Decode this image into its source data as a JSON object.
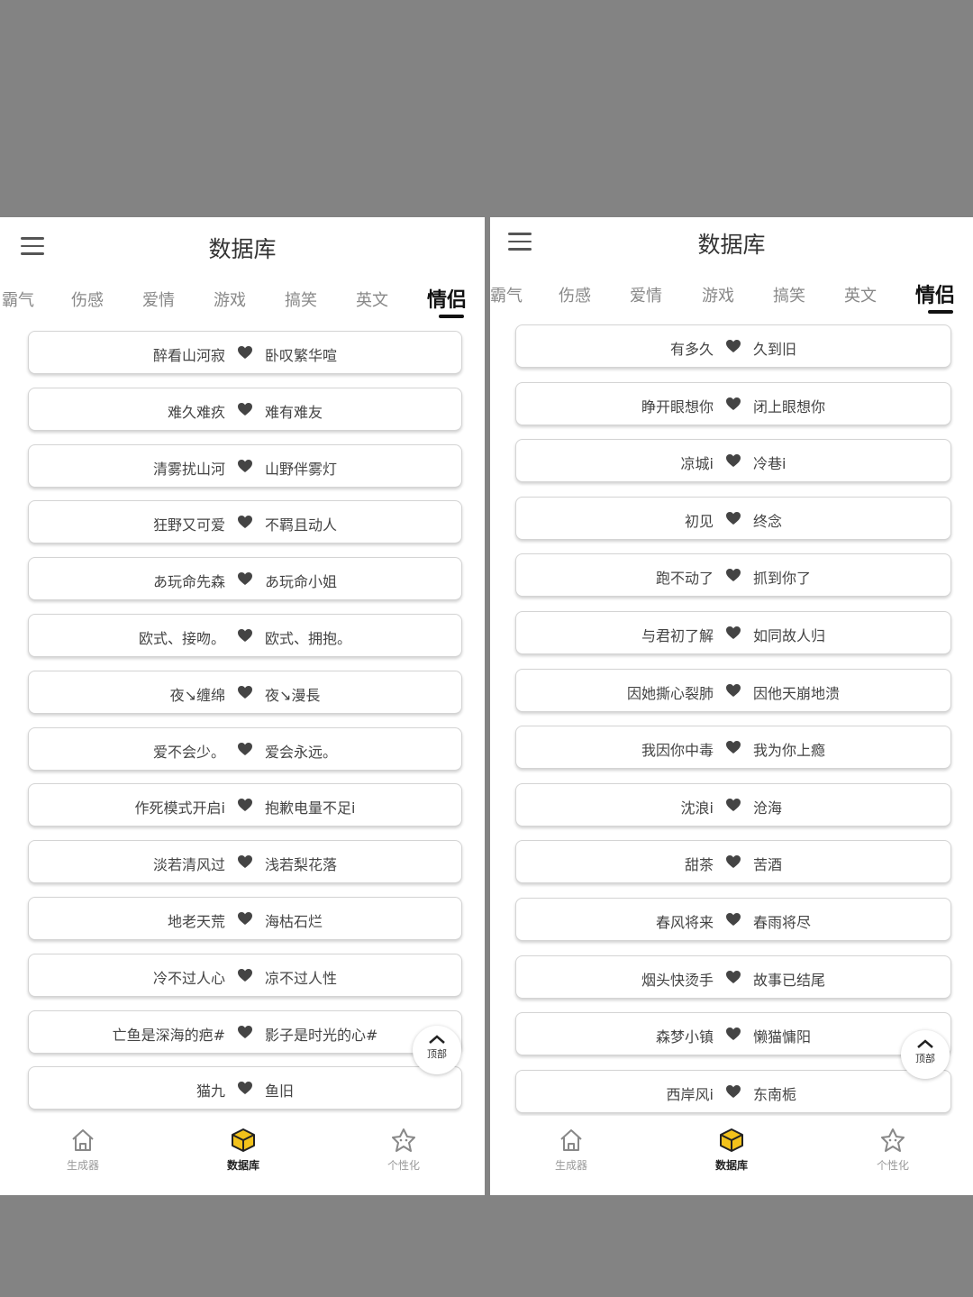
{
  "screens": [
    {
      "title": "数据库",
      "tabs": [
        "霸气",
        "伤感",
        "爱情",
        "游戏",
        "搞笑",
        "英文",
        "情侣"
      ],
      "active_tab": "情侣",
      "pairs": [
        [
          "醉看山河寂",
          "卧叹繁华喧"
        ],
        [
          "难久难疚",
          "难有难友"
        ],
        [
          "清雾扰山河",
          "山野伴雾灯"
        ],
        [
          "狂野又可爱",
          "不羁且动人"
        ],
        [
          "あ玩命先森",
          "あ玩命小姐"
        ],
        [
          "欧式、接吻。",
          "欧式、拥抱。"
        ],
        [
          "夜↘缠绵",
          "夜↘漫長"
        ],
        [
          "爱不会少。",
          "爱会永远。"
        ],
        [
          "作死模式开启i",
          "抱歉电量不足i"
        ],
        [
          "淡若清风过",
          "浅若梨花落"
        ],
        [
          "地老天荒",
          "海枯石烂"
        ],
        [
          "冷不过人心",
          "凉不过人性"
        ],
        [
          "亡鱼是深海的疤#",
          "影子是时光的心#"
        ],
        [
          "猫九",
          "鱼旧"
        ]
      ],
      "back_to_top": "顶部",
      "nav": [
        {
          "label": "生成器",
          "icon": "home-icon"
        },
        {
          "label": "数据库",
          "icon": "cube-icon"
        },
        {
          "label": "个性化",
          "icon": "star-face-icon"
        }
      ]
    },
    {
      "title": "数据库",
      "tabs": [
        "霸气",
        "伤感",
        "爱情",
        "游戏",
        "搞笑",
        "英文",
        "情侣"
      ],
      "active_tab": "情侣",
      "pairs": [
        [
          "有多久",
          "久到旧"
        ],
        [
          "睁开眼想你",
          "闭上眼想你"
        ],
        [
          "凉城i",
          "冷巷i"
        ],
        [
          "初见",
          "终念"
        ],
        [
          "跑不动了",
          "抓到你了"
        ],
        [
          "与君初了解",
          "如同故人归"
        ],
        [
          "因她撕心裂肺",
          "因他天崩地溃"
        ],
        [
          "我因你中毒",
          "我为你上瘾"
        ],
        [
          "沈浪i",
          "沧海"
        ],
        [
          "甜茶",
          "苦酒"
        ],
        [
          "春风将来",
          "春雨将尽"
        ],
        [
          "烟头快烫手",
          "故事已结尾"
        ],
        [
          "森梦小镇",
          "懒猫慵阳"
        ],
        [
          "西岸风i",
          "东南栀"
        ]
      ],
      "back_to_top": "顶部",
      "nav": [
        {
          "label": "生成器",
          "icon": "home-icon"
        },
        {
          "label": "数据库",
          "icon": "cube-icon"
        },
        {
          "label": "个性化",
          "icon": "star-face-icon"
        }
      ]
    }
  ],
  "colors": {
    "background": "#838383",
    "accent": "#f2c21b",
    "text": "#444444"
  }
}
